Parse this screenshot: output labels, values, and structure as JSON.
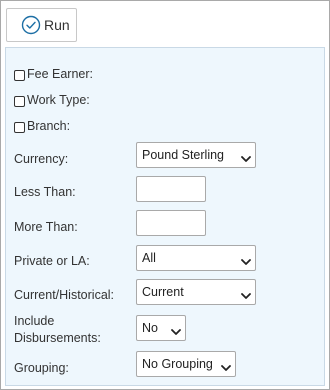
{
  "toolbar": {
    "run_label": "Run"
  },
  "filters": {
    "fee_earner": {
      "label": "Fee Earner:"
    },
    "work_type": {
      "label": "Work Type:"
    },
    "branch": {
      "label": "Branch:"
    }
  },
  "fields": {
    "currency": {
      "label": "Currency:",
      "value": "Pound Sterling"
    },
    "less_than": {
      "label": "Less Than:",
      "value": ""
    },
    "more_than": {
      "label": "More Than:",
      "value": ""
    },
    "private_or_la": {
      "label": "Private or LA:",
      "value": "All"
    },
    "current_historical": {
      "label": "Current/Historical:",
      "value": "Current"
    },
    "include_disbursements": {
      "label_line1": "Include",
      "label_line2": "Disbursements:",
      "value": "No"
    },
    "grouping": {
      "label": "Grouping:",
      "value": "No Grouping"
    }
  },
  "colors": {
    "accent": "#1d6fa5",
    "panel_bg": "#eef7fd"
  }
}
